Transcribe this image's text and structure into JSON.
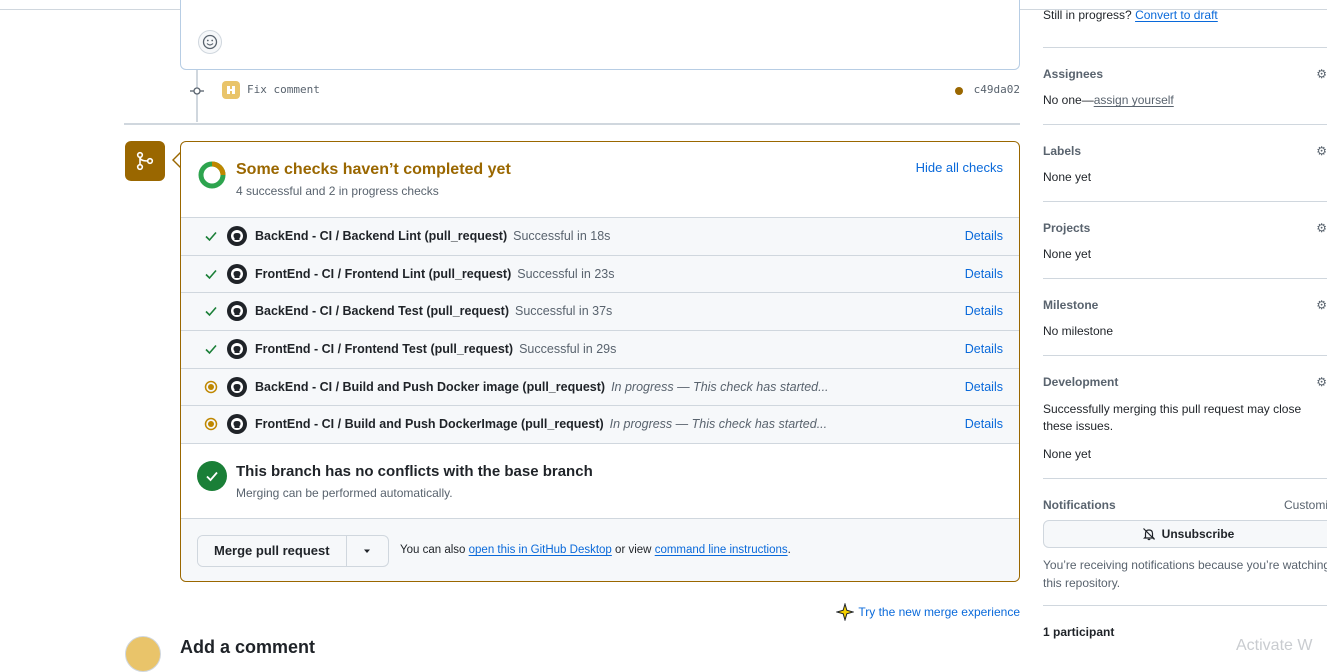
{
  "comment": {
    "emoji_icon": "smiley-icon"
  },
  "commit": {
    "message": "Fix comment",
    "sha": "c49da02"
  },
  "checks": {
    "title": "Some checks haven’t completed yet",
    "subtitle": "4 successful and 2 in progress checks",
    "hide_label": "Hide all checks",
    "items": [
      {
        "name": "BackEnd - CI / Backend Lint (pull_request)",
        "state": "Successful in 18s",
        "status": "success",
        "details": "Details"
      },
      {
        "name": "FrontEnd - CI / Frontend Lint (pull_request)",
        "state": "Successful in 23s",
        "status": "success",
        "details": "Details"
      },
      {
        "name": "BackEnd - CI / Backend Test (pull_request)",
        "state": "Successful in 37s",
        "status": "success",
        "details": "Details"
      },
      {
        "name": "FrontEnd - CI / Frontend Test (pull_request)",
        "state": "Successful in 29s",
        "status": "success",
        "details": "Details"
      },
      {
        "name": "BackEnd - CI / Build and Push Docker image (pull_request)",
        "state": "In progress — This check has started...",
        "status": "progress",
        "details": "Details"
      },
      {
        "name": "FrontEnd - CI / Build and Push DockerImage (pull_request)",
        "state": "In progress — This check has started...",
        "status": "progress",
        "details": "Details"
      }
    ]
  },
  "conflicts": {
    "title": "This branch has no conflicts with the base branch",
    "subtitle": "Merging can be performed automatically."
  },
  "merge": {
    "button_label": "Merge pull request",
    "hint_prefix": "You can also",
    "desktop_link": "open this in GitHub Desktop",
    "hint_middle": "or view",
    "cli_link": "command line instructions",
    "hint_suffix": "."
  },
  "new_merge_experience": "Try the new merge experience",
  "add_comment_title": "Add a comment",
  "sidebar": {
    "draft_prefix": "Still in progress?",
    "draft_link": "Convert to draft",
    "assignees": {
      "label": "Assignees",
      "value_prefix": "No one—",
      "value_link": "assign yourself"
    },
    "labels": {
      "label": "Labels",
      "value": "None yet"
    },
    "projects": {
      "label": "Projects",
      "value": "None yet"
    },
    "milestone": {
      "label": "Milestone",
      "value": "No milestone"
    },
    "development": {
      "label": "Development",
      "desc": "Successfully merging this pull request may close these issues.",
      "value": "None yet"
    },
    "notifications": {
      "label": "Notifications",
      "customize": "Customize",
      "unsubscribe": "Unsubscribe",
      "desc": "You’re receiving notifications because you’re watching this repository."
    },
    "participants": "1 participant"
  },
  "watermark": "Activate W"
}
